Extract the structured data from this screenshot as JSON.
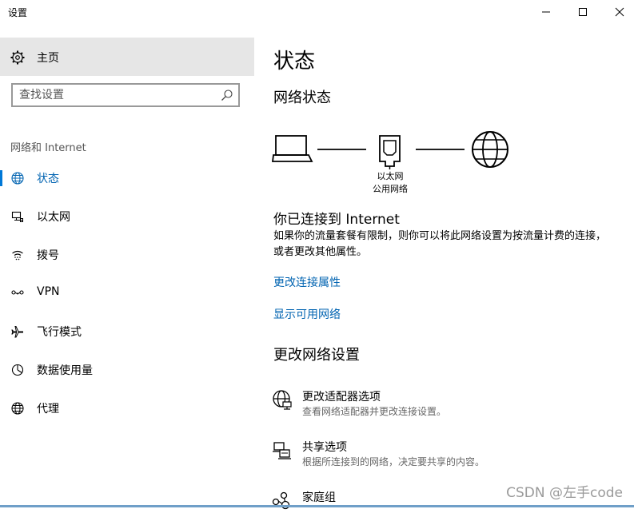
{
  "window": {
    "title": "设置",
    "controls": {
      "minimize": "minimize-icon",
      "maximize": "maximize-icon",
      "close": "close-icon"
    }
  },
  "sidebar": {
    "home_label": "主页",
    "search_placeholder": "查找设置",
    "section_label": "网络和 Internet",
    "items": [
      {
        "label": "状态",
        "icon": "globe-icon",
        "active": true
      },
      {
        "label": "以太网",
        "icon": "ethernet-icon"
      },
      {
        "label": "拨号",
        "icon": "dialup-icon"
      },
      {
        "label": "VPN",
        "icon": "vpn-icon"
      },
      {
        "label": "飞行模式",
        "icon": "airplane-icon"
      },
      {
        "label": "数据使用量",
        "icon": "data-usage-icon"
      },
      {
        "label": "代理",
        "icon": "globe-icon"
      }
    ]
  },
  "main": {
    "title": "状态",
    "network_status_heading": "网络状态",
    "diagram": {
      "adapter_name": "以太网",
      "network_type": "公用网络"
    },
    "connected_title": "你已连接到 Internet",
    "connected_desc": "如果你的流量套餐有限制，则你可以将此网络设置为按流量计费的连接，或者更改其他属性。",
    "links": {
      "change_properties": "更改连接属性",
      "show_available": "显示可用网络"
    },
    "change_heading": "更改网络设置",
    "options": [
      {
        "title": "更改适配器选项",
        "desc": "查看网络适配器并更改连接设置。",
        "icon": "adapter-icon"
      },
      {
        "title": "共享选项",
        "desc": "根据所连接到的网络，决定要共享的内容。",
        "icon": "sharing-icon"
      },
      {
        "title": "家庭组",
        "desc": "",
        "icon": "homegroup-icon"
      }
    ]
  },
  "watermark": "CSDN @左手code",
  "colors": {
    "accent": "#0078d7",
    "link": "#0063b1",
    "home_bg": "#e6e6e6"
  }
}
